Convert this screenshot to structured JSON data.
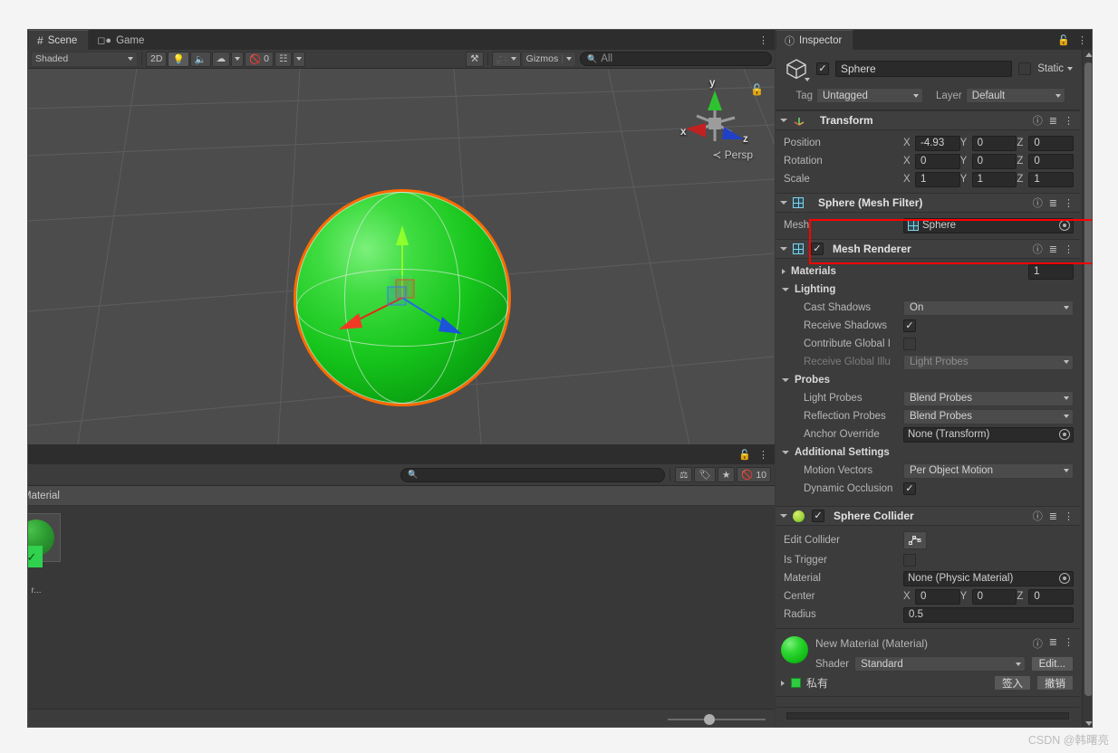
{
  "scene_view": {
    "tabs": [
      {
        "label": "Scene",
        "icon": "hash-icon",
        "active": true
      },
      {
        "label": "Game",
        "icon": "gamepad-icon",
        "active": false
      }
    ],
    "kebab": "⋮",
    "toolbar": {
      "draw_mode": "Shaded",
      "mode_2d": "2D",
      "lighting_icon": "lightbulb-icon",
      "audio_icon": "audio-icon",
      "fx_icon": "effects-icon",
      "hidden_count": "0",
      "hidden_icon": "eye-off-icon",
      "grid_icon": "grid-snap-icon",
      "tools_icon": "tools-icon",
      "camera_icon": "camera-icon",
      "gizmos_label": "Gizmos",
      "search_placeholder": "All",
      "search_icon": "search-icon"
    },
    "gizmo": {
      "x_label": "x",
      "y_label": "y",
      "z_label": "z",
      "persp_label": "Persp",
      "lock_icon": "lock-icon"
    },
    "object_color": "#22cc22",
    "selection_outline_color": "#ff6a00"
  },
  "project_view": {
    "lock_icon": "lock-icon",
    "kebab": "⋮",
    "search_placeholder": "",
    "search_icon": "search-icon",
    "toolbar_icons": [
      "package-icon",
      "label-icon",
      "favorite-star-icon"
    ],
    "hidden_icon": "eye-off-icon",
    "hidden_count": "10",
    "breadcrumb": "Material",
    "asset_label": "r..."
  },
  "inspector": {
    "tab_label": "Inspector",
    "tab_icon": "info-icon",
    "lock_icon": "lock-icon",
    "kebab": "⋮",
    "object": {
      "icon": "cube-icon",
      "enabled": true,
      "name": "Sphere",
      "static_label": "Static",
      "static_checked": false,
      "tag_label": "Tag",
      "tag_value": "Untagged",
      "layer_label": "Layer",
      "layer_value": "Default"
    },
    "components": [
      {
        "id": "transform",
        "title": "Transform",
        "icon": "transform-axes-icon",
        "has_checkbox": false,
        "highlight": false,
        "rows": [
          {
            "label": "Position",
            "type": "vector3",
            "x": "-4.93",
            "y": "0",
            "z": "0"
          },
          {
            "label": "Rotation",
            "type": "vector3",
            "x": "0",
            "y": "0",
            "z": "0"
          },
          {
            "label": "Scale",
            "type": "vector3",
            "x": "1",
            "y": "1",
            "z": "1"
          }
        ]
      },
      {
        "id": "mesh-filter",
        "title": "Sphere (Mesh Filter)",
        "icon": "mesh-filter-icon",
        "has_checkbox": false,
        "highlight": true,
        "rows": [
          {
            "label": "Mesh",
            "type": "object",
            "value": "Sphere",
            "value_icon": "mesh-icon"
          }
        ]
      },
      {
        "id": "mesh-renderer",
        "title": "Mesh Renderer",
        "icon": "mesh-renderer-icon",
        "has_checkbox": true,
        "checked": true,
        "highlight": false,
        "rows": [
          {
            "label": "Materials",
            "type": "foldout-collapsed",
            "value": "1"
          },
          {
            "label": "Lighting",
            "type": "foldout-open"
          },
          {
            "label": "Cast Shadows",
            "type": "dropdown",
            "value": "On",
            "indent": true
          },
          {
            "label": "Receive Shadows",
            "type": "checkbox",
            "checked": true,
            "indent": true
          },
          {
            "label": "Contribute Global I",
            "type": "checkbox",
            "checked": false,
            "indent": true
          },
          {
            "label": "Receive Global Illu",
            "type": "dropdown",
            "value": "Light Probes",
            "indent": true,
            "disabled": true
          },
          {
            "label": "Probes",
            "type": "foldout-open"
          },
          {
            "label": "Light Probes",
            "type": "dropdown",
            "value": "Blend Probes",
            "indent": true
          },
          {
            "label": "Reflection Probes",
            "type": "dropdown",
            "value": "Blend Probes",
            "indent": true
          },
          {
            "label": "Anchor Override",
            "type": "object",
            "value": "None (Transform)",
            "indent": true
          },
          {
            "label": "Additional Settings",
            "type": "foldout-open"
          },
          {
            "label": "Motion Vectors",
            "type": "dropdown",
            "value": "Per Object Motion",
            "indent": true
          },
          {
            "label": "Dynamic Occlusion",
            "type": "checkbox",
            "checked": true,
            "indent": true
          }
        ]
      },
      {
        "id": "sphere-collider",
        "title": "Sphere Collider",
        "icon": "sphere-collider-icon",
        "has_checkbox": true,
        "checked": true,
        "highlight": false,
        "rows": [
          {
            "label": "Edit Collider",
            "type": "button-icon",
            "icon": "edit-collider-icon"
          },
          {
            "label": "Is Trigger",
            "type": "checkbox",
            "checked": false
          },
          {
            "label": "Material",
            "type": "object",
            "value": "None (Physic Material)"
          },
          {
            "label": "Center",
            "type": "vector3",
            "x": "0",
            "y": "0",
            "z": "0"
          },
          {
            "label": "Radius",
            "type": "text",
            "value": "0.5"
          }
        ]
      }
    ],
    "material_block": {
      "title": "New Material (Material)",
      "preview_icon": "material-sphere-icon",
      "shader_label": "Shader",
      "shader_value": "Standard",
      "edit_label": "Edit...",
      "vcs_status": "私有",
      "vcs_checked": true,
      "checkin_label": "签入",
      "revert_label": "撤销"
    }
  },
  "watermark": "CSDN @韩曙亮"
}
